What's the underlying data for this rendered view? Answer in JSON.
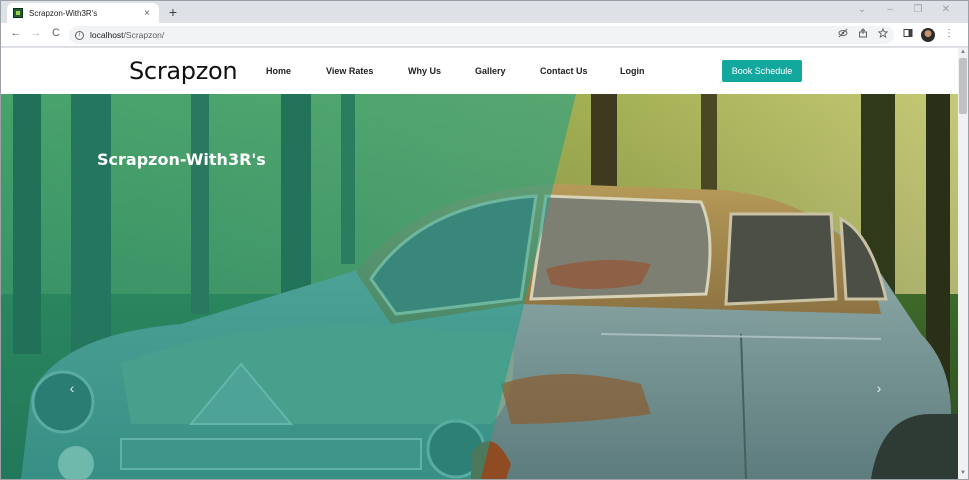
{
  "browser": {
    "tab_title": "Scrapzon-With3R's",
    "new_tab": "+",
    "close_tab": "×",
    "url_host": "localhost",
    "url_path": "/Scrapzon/",
    "window_controls": [
      "⌄",
      "–",
      "❐",
      "✕"
    ],
    "nav": {
      "back": "←",
      "forward": "→",
      "reload": "C"
    },
    "toolbar_icons": [
      "eye-off-icon",
      "share-icon",
      "star-icon",
      "sidepanel-icon",
      "profile-avatar",
      "menu-icon"
    ],
    "more": "⋮"
  },
  "site": {
    "brand": "Scrapzon",
    "nav_items": [
      {
        "label": "Home"
      },
      {
        "label": "View Rates"
      },
      {
        "label": "Why Us"
      },
      {
        "label": "Gallery"
      },
      {
        "label": "Contact Us"
      },
      {
        "label": "Login"
      }
    ],
    "cta_label": "Book Schedule",
    "hero_title": "Scrapzon-With3R's",
    "carousel_prev": "‹",
    "carousel_next": "›"
  },
  "colors": {
    "accent": "#13a89e",
    "overlay": "#1a9e8a"
  }
}
